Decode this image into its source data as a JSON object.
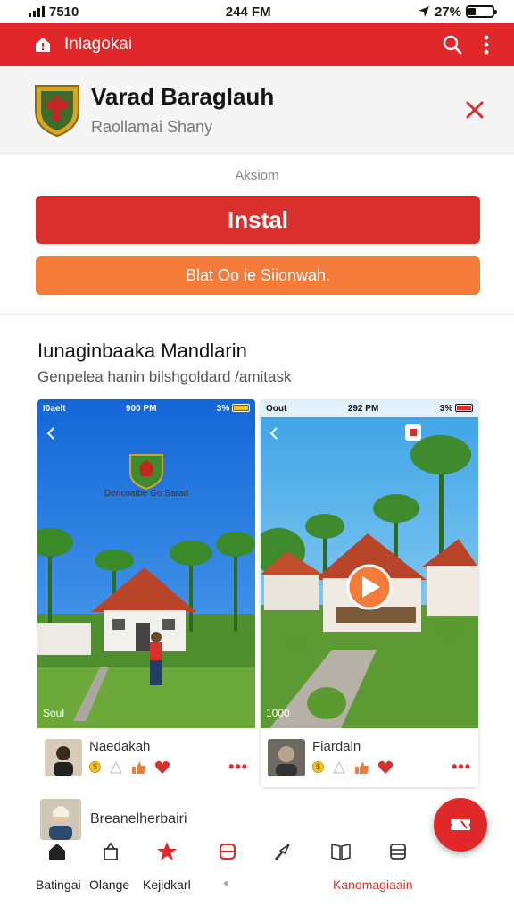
{
  "status_bar": {
    "time_left": "7510",
    "time_center": "244 FM",
    "battery": "27%"
  },
  "app_bar": {
    "title": "Inlagokai"
  },
  "banner": {
    "title": "Varad Baraglauh",
    "subtitle": "Raollamai Shany"
  },
  "actions": {
    "caption": "Aksiom",
    "install_label": "Instal",
    "secondary_label": "Blat Oo ie Siionwah."
  },
  "section": {
    "title": "Iunaginbaaka Mandlarin",
    "subtitle": "Genpelea hanin bilshgoldard /amitask"
  },
  "screenshots": [
    {
      "status_left": "I0aelt",
      "status_time": "900 PM",
      "status_right": "3%",
      "caption": "Dencoatbe Go Sarad",
      "watermark": "Soul",
      "author": "Naedakah"
    },
    {
      "status_left": "Oout",
      "status_time": "292 PM",
      "status_right": "3%",
      "watermark": "1000",
      "author": "Fiardaln"
    }
  ],
  "comment": {
    "author": "Breanelherbairi"
  },
  "bottom_nav": [
    {
      "label": "Batingai"
    },
    {
      "label": "Olange"
    },
    {
      "label": "Kejidkarl"
    },
    {
      "label": ""
    },
    {
      "label": ""
    },
    {
      "label": "Kanomagiaain"
    },
    {
      "label": ""
    }
  ],
  "colors": {
    "brand_red": "#e0282a",
    "install_red": "#d9302d",
    "orange": "#f47b3a"
  }
}
